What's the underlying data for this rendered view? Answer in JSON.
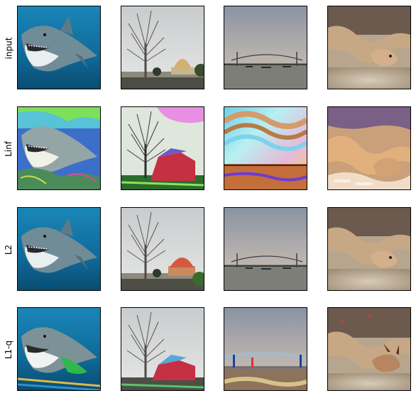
{
  "rows": [
    {
      "label": "input",
      "style": "clean"
    },
    {
      "label": "Linf",
      "style": "linf"
    },
    {
      "label": "L2",
      "style": "l2"
    },
    {
      "label": "L1-q",
      "style": "l1q"
    }
  ],
  "columns": [
    {
      "subject": "shark",
      "icon": "shark-photo"
    },
    {
      "subject": "tree-and-dome-building",
      "icon": "tree-dome-photo"
    },
    {
      "subject": "bridge-over-water",
      "icon": "bridge-photo"
    },
    {
      "subject": "rattlesnake-on-sand",
      "icon": "snake-photo"
    }
  ]
}
